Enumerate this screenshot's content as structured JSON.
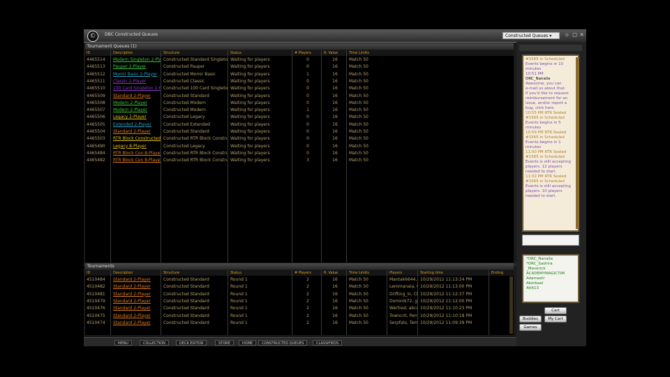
{
  "app": {
    "title": "DBC Constructed Queues",
    "queue_selector": "Constructed Queues",
    "logo": "©"
  },
  "queues": {
    "section_title": "Tournament Queues (1)",
    "columns": [
      "ID",
      "Description",
      "Structure",
      "Status",
      "# Players",
      "R. Value",
      "Time Limits"
    ],
    "rows": [
      {
        "id": "4465514",
        "desc": "Modern Singleton 2-Player",
        "desc_color": "#3ec83e",
        "structure": "Constructed Standard Singleton",
        "status": "Waiting for players",
        "players": "0",
        "value": "16",
        "time": "Match 50"
      },
      {
        "id": "4465513",
        "desc": "Pauper 2-Player",
        "desc_color": "#3ec83e",
        "structure": "Constructed Pauper",
        "status": "Waiting for players",
        "players": "0",
        "value": "16",
        "time": "Match 50"
      },
      {
        "id": "4465512",
        "desc": "Momir Basic 2-Player",
        "desc_color": "#2aa0c0",
        "structure": "Constructed Momir Basic",
        "status": "Waiting for players",
        "players": "1",
        "value": "16",
        "time": "Match 50"
      },
      {
        "id": "4465511",
        "desc": "Classic 2-Player",
        "desc_color": "#8a3ac8",
        "structure": "Constructed Classic",
        "status": "Waiting for players",
        "players": "0",
        "value": "16",
        "time": "Match 50"
      },
      {
        "id": "4465510",
        "desc": "100 Card Singleton 2-Player",
        "desc_color": "#8a3ac8",
        "structure": "Constructed 100 Card Singleton",
        "status": "Waiting for players",
        "players": "0",
        "value": "16",
        "time": "Match 50"
      },
      {
        "id": "4465509",
        "desc": "Standard 2-Player",
        "desc_color": "#e07a20",
        "structure": "Constructed Standard",
        "status": "Waiting for players",
        "players": "0",
        "value": "16",
        "time": "Match 50"
      },
      {
        "id": "4465508",
        "desc": "Modern 2-Player",
        "desc_color": "#3ec83e",
        "structure": "Constructed Modern",
        "status": "Waiting for players",
        "players": "0",
        "value": "16",
        "time": "Match 50"
      },
      {
        "id": "4465507",
        "desc": "Modern 2-Player",
        "desc_color": "#3ec83e",
        "structure": "Constructed Modern",
        "status": "Waiting for players",
        "players": "1",
        "value": "16",
        "time": "Match 50"
      },
      {
        "id": "4465506",
        "desc": "Legacy 2-Player",
        "desc_color": "#e0c020",
        "structure": "Constructed Legacy",
        "status": "Waiting for players",
        "players": "0",
        "value": "16",
        "time": "Match 50"
      },
      {
        "id": "4465505",
        "desc": "Extended 2-Player",
        "desc_color": "#2aa0c0",
        "structure": "Constructed Extended",
        "status": "Waiting for players",
        "players": "0",
        "value": "16",
        "time": "Match 50"
      },
      {
        "id": "4465504",
        "desc": "Standard 2-Player",
        "desc_color": "#e07a20",
        "structure": "Constructed Standard",
        "status": "Waiting for players",
        "players": "0",
        "value": "16",
        "time": "Match 50"
      },
      {
        "id": "4465503",
        "desc": "RTR Block Constructed 8-Pla",
        "desc_color": "#e0c020",
        "structure": "Constructed RTR Block Constructed",
        "status": "Waiting for players",
        "players": "0",
        "value": "16",
        "time": "Match 50"
      },
      {
        "id": "4465490",
        "desc": "Legacy 8-Player",
        "desc_color": "#e0c020",
        "structure": "Constructed Legacy",
        "status": "Waiting for players",
        "players": "0",
        "value": "16",
        "time": "Match 50"
      },
      {
        "id": "4465484",
        "desc": "RTR Block Con 8-Player",
        "desc_color": "#e07a20",
        "structure": "Constructed RTR Block Constructed",
        "status": "Waiting for players",
        "players": "0",
        "value": "16",
        "time": "Match 50"
      },
      {
        "id": "4465482",
        "desc": "RTR Block Con 8-Player",
        "desc_color": "#e07a20",
        "structure": "Constructed RTR Block Constructed",
        "status": "Waiting for players",
        "players": "3",
        "value": "16",
        "time": "Match 50"
      }
    ]
  },
  "tournaments": {
    "section_title": "Tournaments",
    "columns": [
      "ID",
      "Description",
      "Structure",
      "Status",
      "# Players",
      "R. Value",
      "Time Limits",
      "Players",
      "Starting time",
      "Ending"
    ],
    "rows": [
      {
        "id": "4510484",
        "desc": "Standard 2-Player",
        "structure": "Constructed Standard",
        "status": "Round 1",
        "players": "2",
        "value": "16",
        "time": "Match 50",
        "names": "Mantak6644, D",
        "start": "10/29/2012 11:13:24 PM"
      },
      {
        "id": "4510482",
        "desc": "Standard 2-Player",
        "structure": "Constructed Standard",
        "status": "Round 1",
        "players": "2",
        "value": "16",
        "time": "Match 50",
        "names": "Lemmanaia, C",
        "start": "10/29/2012 11:13:00 PM"
      },
      {
        "id": "4510481",
        "desc": "Standard 2-Player",
        "structure": "Constructed Standard",
        "status": "Round 1",
        "players": "2",
        "value": "16",
        "time": "Match 50",
        "names": "Drifting_in, Ch",
        "start": "10/29/2012 11:12:37 PM"
      },
      {
        "id": "4510479",
        "desc": "Standard 2-Player",
        "structure": "Constructed Standard",
        "status": "Round 1",
        "players": "2",
        "value": "16",
        "time": "Match 50",
        "names": "Dominik72, g",
        "start": "10/29/2012 11:12:00 PM"
      },
      {
        "id": "4510476",
        "desc": "Standard 2-Player",
        "structure": "Constructed Standard",
        "status": "Round 1",
        "players": "2",
        "value": "16",
        "time": "Match 50",
        "names": "Wertred, abco",
        "start": "10/29/2012 11:10:23 PM"
      },
      {
        "id": "4510475",
        "desc": "Standard 2-Player",
        "structure": "Constructed Standard",
        "status": "Round 1",
        "players": "2",
        "value": "16",
        "time": "Match 50",
        "names": "Towncrit, Pent",
        "start": "10/29/2012 11:10:18 PM"
      },
      {
        "id": "4510474",
        "desc": "Standard 2-Player",
        "structure": "Constructed Standard",
        "status": "Round 1",
        "players": "2",
        "value": "16",
        "time": "Match 50",
        "names": "Serpfalo, Tem",
        "start": "10/29/2012 11:09:39 PM"
      }
    ]
  },
  "chat": {
    "lines": [
      {
        "text": "#1565 in Scheduled",
        "color": "#b07a30"
      },
      {
        "text": "Events begins in 10",
        "color": "#7a4ab0"
      },
      {
        "text": "minutes",
        "color": "#7a4ab0"
      },
      {
        "text": "10:51 PM",
        "color": "#7a4ab0"
      },
      {
        "text": "ORC_Nanaila",
        "color": "#000000"
      },
      {
        "text": "Awesome, you can",
        "color": "#7a4ab0"
      },
      {
        "text": "e-mail us about that.",
        "color": "#7a4ab0"
      },
      {
        "text": "If you'd like to request",
        "color": "#7a4ab0"
      },
      {
        "text": "reimbursement for an",
        "color": "#7a4ab0"
      },
      {
        "text": "issue, and/or report a",
        "color": "#7a4ab0"
      },
      {
        "text": "bug, click here.",
        "color": "#7a4ab0"
      },
      {
        "text": "10:55 PM RTR Sealed",
        "color": "#b07a30"
      },
      {
        "text": "#1565 in Scheduled",
        "color": "#b07a30"
      },
      {
        "text": "Events begins in 5",
        "color": "#7a4ab0"
      },
      {
        "text": "minutes",
        "color": "#7a4ab0"
      },
      {
        "text": "10:59 PM RTR Sealed",
        "color": "#b07a30"
      },
      {
        "text": "#1565 in Scheduled",
        "color": "#b07a30"
      },
      {
        "text": "Events begins in 1",
        "color": "#7a4ab0"
      },
      {
        "text": "minutes",
        "color": "#7a4ab0"
      },
      {
        "text": "11:00 PM RTR Sealed",
        "color": "#b07a30"
      },
      {
        "text": "#1565 in Scheduled",
        "color": "#b07a30"
      },
      {
        "text": "Events is still accepting",
        "color": "#7a4ab0"
      },
      {
        "text": "players. 12 players",
        "color": "#7a4ab0"
      },
      {
        "text": "needed to start.",
        "color": "#7a4ab0"
      },
      {
        "text": "11:02 PM RTR Sealed",
        "color": "#b07a30"
      },
      {
        "text": "#1565 in Scheduled",
        "color": "#b07a30"
      },
      {
        "text": "Events is still accepting",
        "color": "#7a4ab0"
      },
      {
        "text": "players. 10 players",
        "color": "#7a4ab0"
      },
      {
        "text": "needed to start.",
        "color": "#7a4ab0"
      }
    ]
  },
  "buddies": [
    "*ORC_Nanaila",
    "*ORC_Sashira",
    "_Maverick",
    "ACADEMYMAGICTIM",
    "Adamastr",
    "Akorbaal",
    "Atilt13"
  ],
  "buttons": {
    "cart": "Cart",
    "buddies": "Buddies",
    "my_cart": "My Cart",
    "games": "Games"
  },
  "bottom_tabs": [
    "MENU",
    "COLLECTION",
    "DECK EDITOR",
    "STORE",
    "HOME",
    "CONSTRUCTED QUEUES",
    "CLASSIFIEDS"
  ]
}
